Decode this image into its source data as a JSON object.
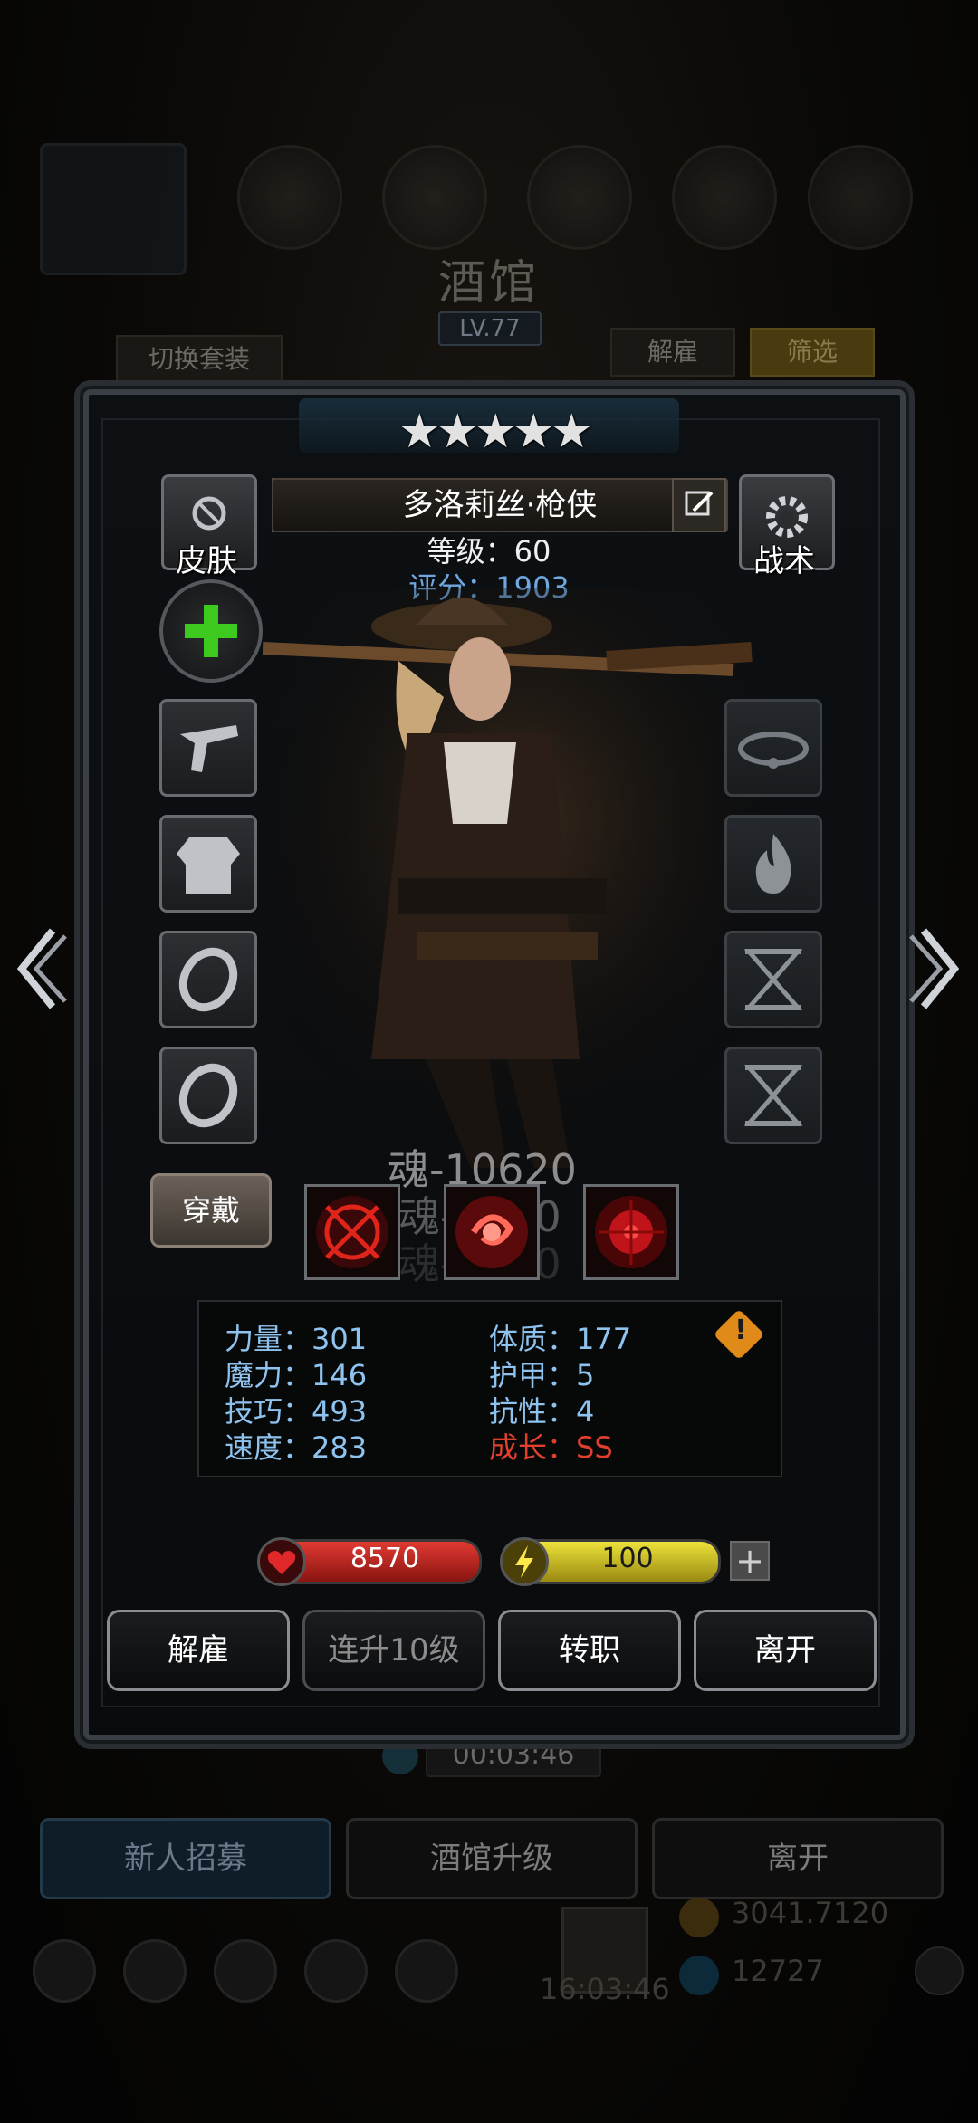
{
  "background": {
    "title": "酒馆",
    "level": "LV.77",
    "switch_outfit_label": "切换套装",
    "dismiss_label": "解雇",
    "filter_label": "筛选",
    "timer": "00:03:46",
    "bottom_buttons": [
      "新人招募",
      "酒馆升级",
      "离开"
    ],
    "resource_gold": "3041.7120",
    "resource_gem": "12727",
    "clock": "16:03:46"
  },
  "hero": {
    "stars": 5,
    "name": "多洛莉丝·枪侠",
    "level_label": "等级：60",
    "score_label": "评分：1903",
    "skin_label": "皮肤",
    "tactics_label": "战术",
    "wear_label": "穿戴",
    "soul_texts": [
      "魂-10620",
      "魂-3000",
      "魂-7000"
    ]
  },
  "stats": [
    {
      "label": "力量：301",
      "color": "#8fc3ef"
    },
    {
      "label": "魔力：146",
      "color": "#8fc3ef"
    },
    {
      "label": "技巧：493",
      "color": "#8fc3ef"
    },
    {
      "label": "速度：283",
      "color": "#8fc3ef"
    },
    {
      "label": "体质：177",
      "color": "#8fc3ef"
    },
    {
      "label": "护甲：5",
      "color": "#8fc3ef"
    },
    {
      "label": "抗性：4",
      "color": "#8fc3ef"
    },
    {
      "label": "成长：SS",
      "color": "#e2402e"
    }
  ],
  "hp": {
    "value": "8570",
    "color": "#c8231c"
  },
  "energy": {
    "value": "100",
    "color": "#d8c21a"
  },
  "actions": [
    "解雇",
    "连升10级",
    "转职",
    "离开"
  ],
  "icons": {
    "skin": "armor-swap-icon",
    "tactics": "gear-icon",
    "add": "plus-icon",
    "left": "chevron-left-icon",
    "right": "chevron-right-icon"
  }
}
